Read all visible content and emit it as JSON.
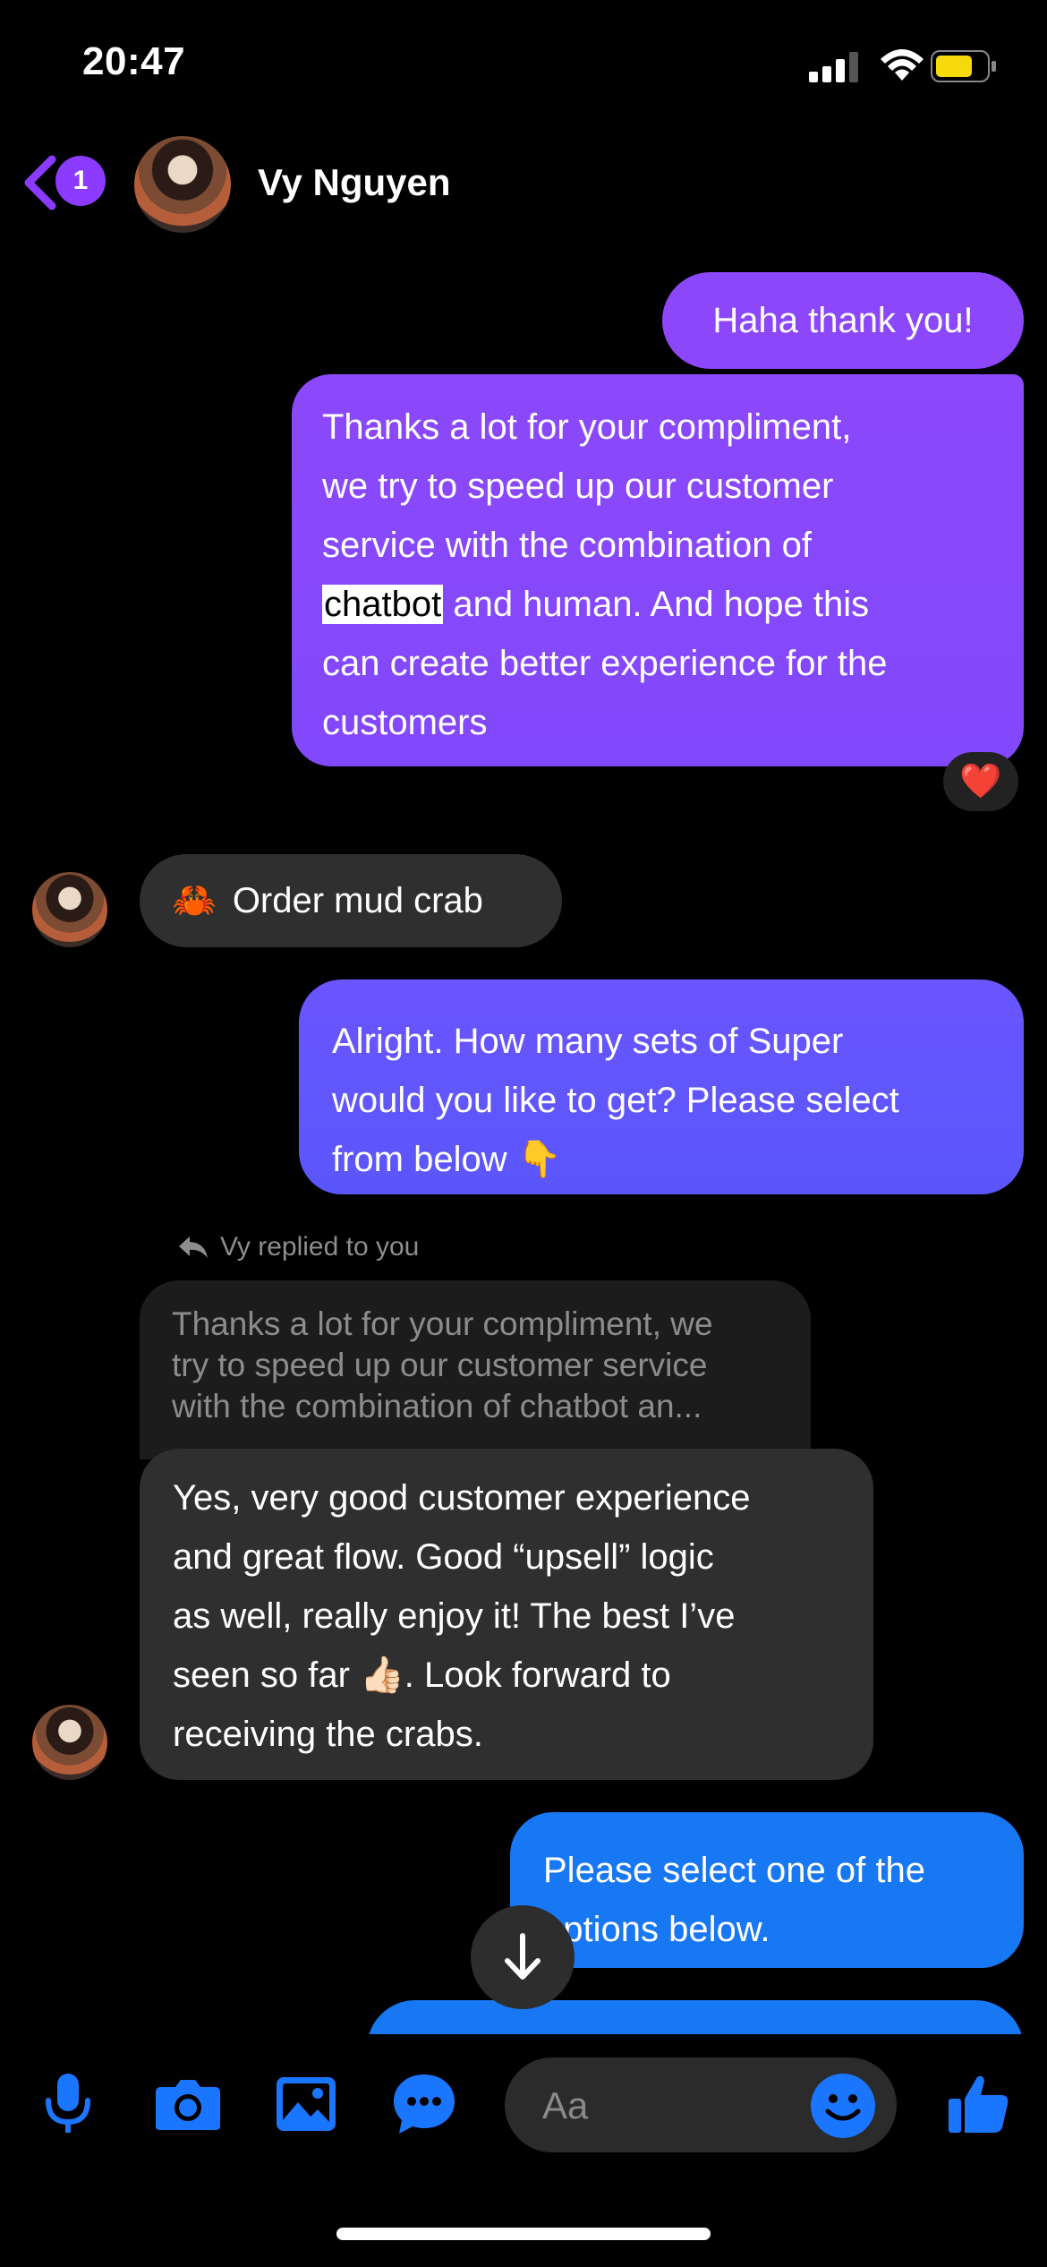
{
  "status_bar": {
    "time": "20:47"
  },
  "header": {
    "back_badge": "1",
    "contact_name": "Vy Nguyen"
  },
  "messages": {
    "haha": "Haha thank you!",
    "thanks_lines": [
      "Thanks a lot for your compliment,",
      "we try to speed up our customer",
      "service with the combination of"
    ],
    "thanks_highlight": "chatbot",
    "thanks_line4_rest": " and human. And hope this",
    "thanks_lines_tail": [
      "can create better experience for the",
      "customers"
    ],
    "reaction": "❤️",
    "order_emoji": "🦀",
    "order_text": "Order mud crab",
    "alright_lines": [
      "Alright. How many sets of Super",
      "would you like to get? Please select",
      "from below  👇"
    ],
    "reply_label": "Vy replied to you",
    "quoted_lines": [
      "Thanks a lot for your compliment, we",
      "try to speed up our customer service",
      "with the combination of chatbot an..."
    ],
    "yes_lines": [
      "Yes, very good customer experience",
      "and great flow. Good “upsell” logic",
      "as well, really enjoy it! The best I’ve",
      "seen so far 👍🏻. Look forward to",
      "receiving the crabs."
    ],
    "please_lines": [
      "Please select one of the",
      "options below."
    ]
  },
  "composer": {
    "placeholder": "Aa"
  },
  "colors": {
    "accent_purple": "#8a4cff",
    "accent_blue": "#1877f2",
    "incoming_bubble": "#2f2f2f"
  },
  "icons": [
    "back-chevron-icon",
    "signal-icon",
    "wifi-icon",
    "battery-icon",
    "mic-icon",
    "camera-icon",
    "gallery-icon",
    "chat-icon",
    "emoji-icon",
    "like-icon",
    "reply-arrow-icon",
    "arrow-down-icon"
  ]
}
